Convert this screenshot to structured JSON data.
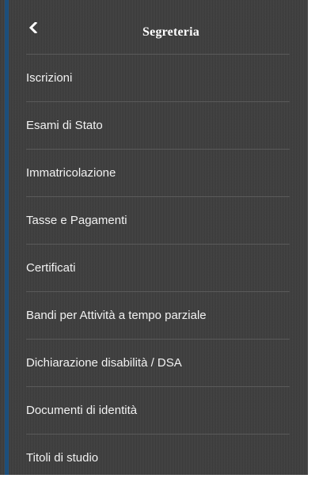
{
  "header": {
    "title": "Segreteria",
    "back_icon": "chevron-left-icon"
  },
  "colors": {
    "panel_background": "#404040",
    "accent": "#1c4f7c",
    "text": "#f2f2f2",
    "divider": "#5a5a5a"
  },
  "menu": {
    "items": [
      {
        "label": "Iscrizioni"
      },
      {
        "label": "Esami di Stato"
      },
      {
        "label": "Immatricolazione"
      },
      {
        "label": "Tasse e Pagamenti"
      },
      {
        "label": "Certificati"
      },
      {
        "label": "Bandi per Attività a tempo parziale"
      },
      {
        "label": "Dichiarazione disabilità / DSA"
      },
      {
        "label": "Documenti di identità"
      },
      {
        "label": "Titoli di studio"
      }
    ]
  }
}
